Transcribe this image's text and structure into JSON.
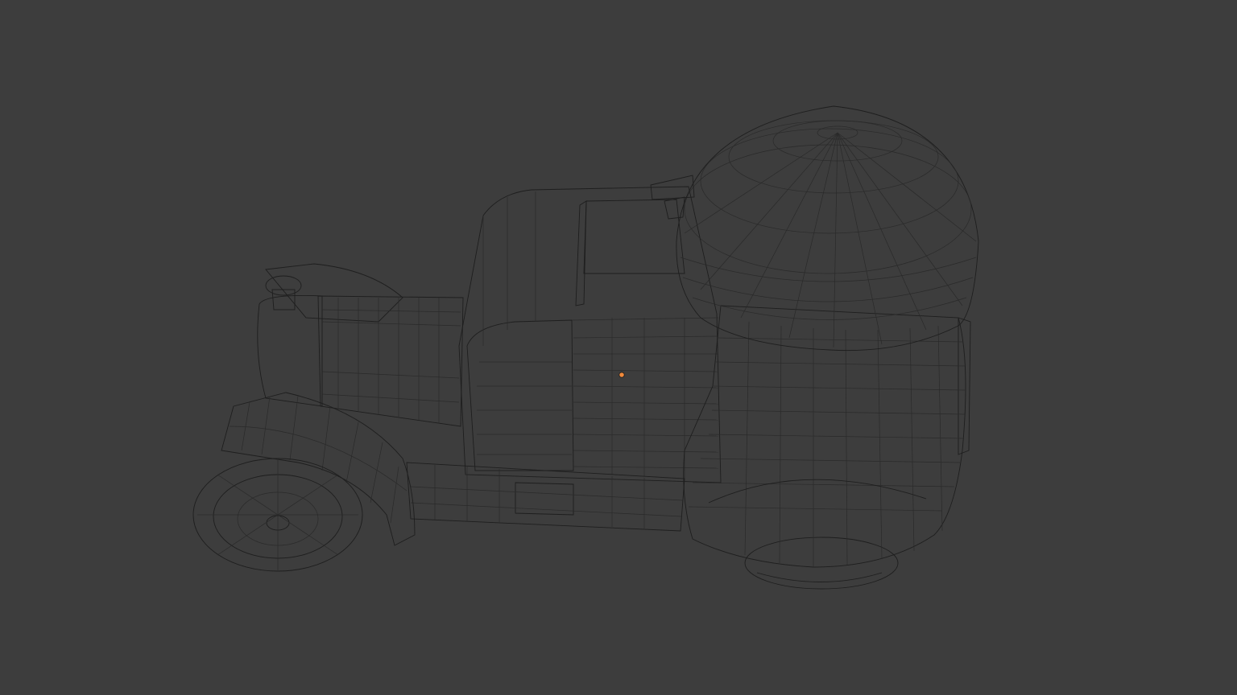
{
  "viewport": {
    "background_color": "#3d3d3d",
    "mesh_base_color": "#8a8c8c",
    "mesh_highlight_color": "#c9cbcb",
    "mesh_shadow_color": "#6e7070",
    "wire_color": "#1e1e1e",
    "origin_color": "#f08a3c"
  },
  "object": {
    "icon": "object-origin-icon"
  }
}
